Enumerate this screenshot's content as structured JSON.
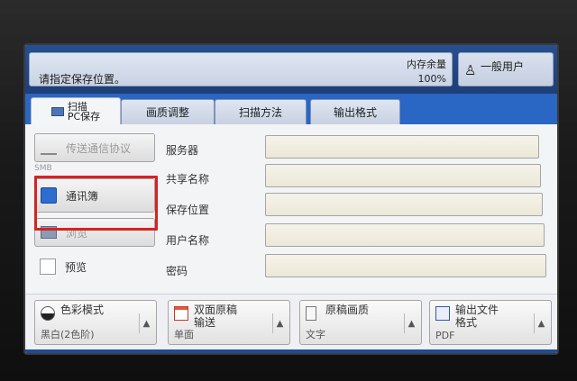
{
  "header": {
    "message": "请指定保存位置。",
    "memory_label": "内存余量",
    "memory_value": "100%",
    "user_label": "一般用户"
  },
  "tabs": [
    {
      "line1": "扫描",
      "line2": "PC保存"
    },
    {
      "label": "画质调整"
    },
    {
      "label": "扫描方法"
    },
    {
      "label": "输出格式"
    }
  ],
  "left_buttons": {
    "protocol": "传送通信协议",
    "note": "SMB",
    "address_book": "通讯簿",
    "browse": "浏览",
    "preview": "预览"
  },
  "fields": {
    "server": "服务器",
    "share_name": "共享名称",
    "save_location": "保存位置",
    "username": "用户名称",
    "password": "密码"
  },
  "bottom_buttons": [
    {
      "title": "色彩模式",
      "value": "黑白(2色阶)"
    },
    {
      "title1": "双面原稿",
      "title2": "输送",
      "value": "单面"
    },
    {
      "title": "原稿画质",
      "value": "文字"
    },
    {
      "title1": "输出文件",
      "title2": "格式",
      "value": "PDF"
    }
  ],
  "colors": {
    "header_blue": "#274f8f",
    "tab_bar_blue": "#2a66c3",
    "highlight_red": "#d62323",
    "input_fill": "#f5f3e9"
  }
}
